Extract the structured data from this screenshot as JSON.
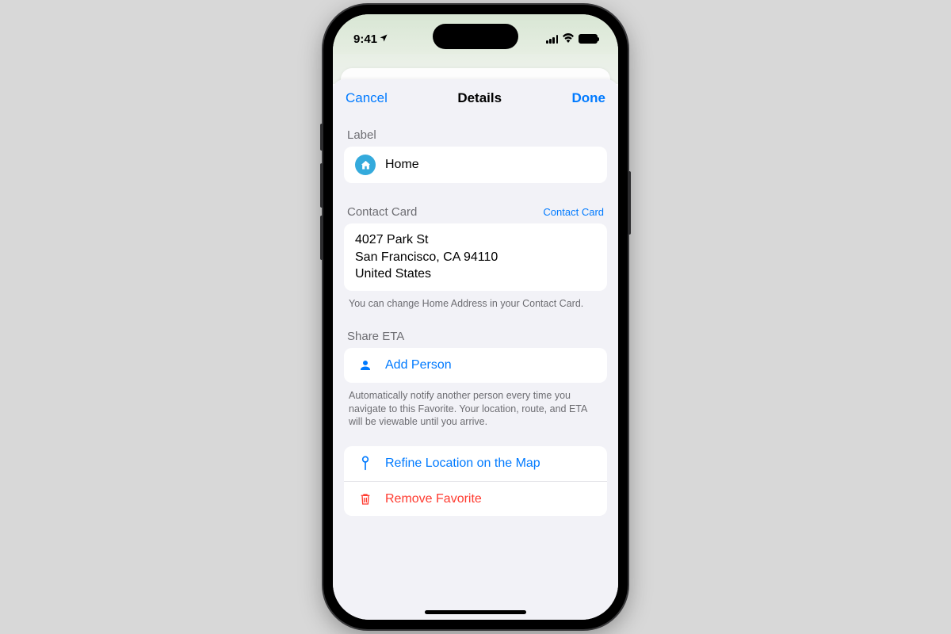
{
  "status": {
    "time": "9:41",
    "location_arrow": "➤"
  },
  "nav": {
    "cancel": "Cancel",
    "title": "Details",
    "done": "Done"
  },
  "label_section": {
    "header": "Label",
    "value": "Home"
  },
  "contact_section": {
    "header": "Contact Card",
    "link": "Contact Card",
    "address_line1": "4027 Park St",
    "address_line2": "San Francisco, CA 94110",
    "address_line3": "United States",
    "note": "You can change Home Address in your Contact Card."
  },
  "share_section": {
    "header": "Share ETA",
    "add_person": "Add Person",
    "note": "Automatically notify another person every time you navigate to this Favorite. Your location, route, and ETA will be viewable until you arrive."
  },
  "actions": {
    "refine": "Refine Location on the Map",
    "remove": "Remove Favorite"
  }
}
